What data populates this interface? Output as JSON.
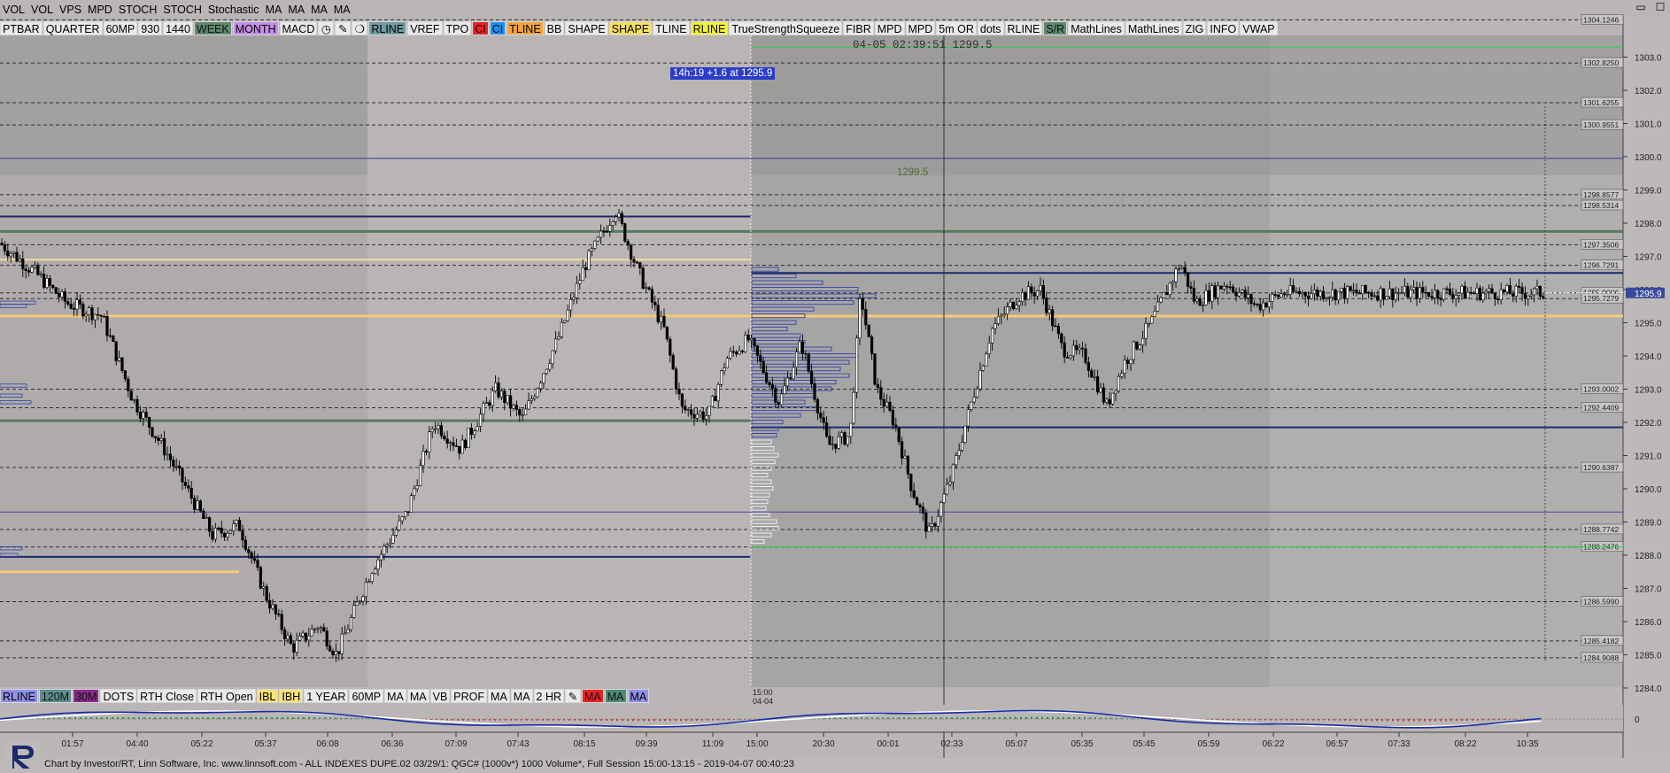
{
  "toolbar_top": [
    "VOL",
    "VOL",
    "VPS",
    "MPD",
    "STOCH",
    "STOCH",
    "Stochastic",
    "MA",
    "MA",
    "MA",
    "MA"
  ],
  "toolbar_main": [
    {
      "label": "PTBAR",
      "bg": "#eaeaea"
    },
    {
      "label": "QUARTER",
      "bg": "#eaeaea"
    },
    {
      "label": "60MP",
      "bg": "#eaeaea"
    },
    {
      "label": "930",
      "bg": "#eaeaea"
    },
    {
      "label": "1440",
      "bg": "#eaeaea"
    },
    {
      "label": "WEEK",
      "bg": "#5e8a6f"
    },
    {
      "label": "MONTH",
      "bg": "#c58ee8"
    },
    {
      "label": "MACD",
      "bg": "#eaeaea"
    },
    {
      "label": "clock-icon",
      "bg": "#eaeaea",
      "icon": true,
      "glyph": "◷"
    },
    {
      "label": "pencil-icon",
      "bg": "#eaeaea",
      "icon": true,
      "glyph": "✎"
    },
    {
      "label": "dropper-icon",
      "bg": "#eaeaea",
      "icon": true,
      "glyph": "❍"
    },
    {
      "label": "RLINE",
      "bg": "#6f9ba2"
    },
    {
      "label": "VREF",
      "bg": "#eaeaea"
    },
    {
      "label": "TPO",
      "bg": "#eaeaea"
    },
    {
      "label": "CI",
      "bg": "#ee2222"
    },
    {
      "label": "CI",
      "bg": "#1f8ff0"
    },
    {
      "label": "TLINE",
      "bg": "#f3a33a"
    },
    {
      "label": "BB",
      "bg": "#eaeaea"
    },
    {
      "label": "SHAPE",
      "bg": "#eaeaea"
    },
    {
      "label": "SHAPE",
      "bg": "#f7df62"
    },
    {
      "label": "TLINE",
      "bg": "#eaeaea"
    },
    {
      "label": "RLINE",
      "bg": "#f2f23a"
    },
    {
      "label": "TrueStrengthSqueeze",
      "bg": "#eaeaea"
    },
    {
      "label": "FIBR",
      "bg": "#eaeaea"
    },
    {
      "label": "MPD",
      "bg": "#eaeaea"
    },
    {
      "label": "MPD",
      "bg": "#eaeaea"
    },
    {
      "label": "5m OR",
      "bg": "#eaeaea"
    },
    {
      "label": "dots",
      "bg": "#eaeaea"
    },
    {
      "label": "RLINE",
      "bg": "#eaeaea"
    },
    {
      "label": "S/R",
      "bg": "#5e8a6f"
    },
    {
      "label": "MathLines",
      "bg": "#eaeaea"
    },
    {
      "label": "MathLines",
      "bg": "#eaeaea"
    },
    {
      "label": "ZIG",
      "bg": "#eaeaea"
    },
    {
      "label": "INFO",
      "bg": "#eaeaea"
    },
    {
      "label": "VWAP",
      "bg": "#eaeaea"
    }
  ],
  "toolbar_bottom": [
    {
      "label": "RLINE",
      "bg": "#8f8fe8"
    },
    {
      "label": "120M",
      "bg": "#5c8f8c"
    },
    {
      "label": "30M",
      "bg": "#8a2a8a"
    },
    {
      "label": "DOTS",
      "bg": "#eaeaea"
    },
    {
      "label": "RTH Close",
      "bg": "#eaeaea"
    },
    {
      "label": "RTH Open",
      "bg": "#eaeaea"
    },
    {
      "label": "IBL",
      "bg": "#f7e27a"
    },
    {
      "label": "IBH",
      "bg": "#f7e27a"
    },
    {
      "label": "1 YEAR",
      "bg": "#eaeaea"
    },
    {
      "label": "60MP",
      "bg": "#eaeaea"
    },
    {
      "label": "MA",
      "bg": "#eaeaea"
    },
    {
      "label": "MA",
      "bg": "#eaeaea"
    },
    {
      "label": "VB",
      "bg": "#eaeaea"
    },
    {
      "label": "PROF",
      "bg": "#eaeaea"
    },
    {
      "label": "MA",
      "bg": "#eaeaea"
    },
    {
      "label": "MA",
      "bg": "#eaeaea"
    },
    {
      "label": "2 HR",
      "bg": "#eaeaea"
    },
    {
      "label": "pencil-icon",
      "bg": "#eaeaea",
      "icon": true,
      "glyph": "✎"
    },
    {
      "label": "MA",
      "bg": "#ee2222"
    },
    {
      "label": "MA",
      "bg": "#4f8a78"
    },
    {
      "label": "MA",
      "bg": "#8f8fe8"
    }
  ],
  "cursor_readout": "04-05 02:39:51  1299.5",
  "callout": "14h:19  +1.6 at 1295.9",
  "level_label": "1299.5",
  "session_marker": [
    "15:00",
    "04-04"
  ],
  "footer_text": "Chart by Investor/RT, Linn Software, Inc. www.linnsoft.com - ALL INDEXES DUPE.02    03/29/1: QGC# (1000v*) 1000 Volume*, Full Session 15:00-13:15 - 2019-04-07 00:40:23",
  "window_controls": [
    "▭",
    "☐"
  ],
  "chart_data": {
    "type": "candlestick",
    "symbol": "QGC# (1000v*)",
    "ylim": [
      1283.3,
      1304.6
    ],
    "y_ticks": [
      1284.0,
      1285.0,
      1286.0,
      1287.0,
      1288.0,
      1289.0,
      1290.0,
      1291.0,
      1292.0,
      1293.0,
      1294.0,
      1295.0,
      1296.0,
      1297.0,
      1298.0,
      1299.0,
      1300.0,
      1301.0,
      1302.0,
      1303.0
    ],
    "x_tick_labels": [
      "01:57",
      "04:40",
      "05:22",
      "05:37",
      "06:08",
      "06:36",
      "07:09",
      "07:43",
      "08:15",
      "09:39",
      "11:09",
      "15:00",
      "20:30",
      "00:01",
      "02:33",
      "05:07",
      "05:35",
      "05:45",
      "05:59",
      "06:22",
      "06:57",
      "07:33",
      "08:22",
      "10:35"
    ],
    "price_levels": [
      {
        "price": 1304.1246,
        "label": "1304.1246",
        "style": "dash",
        "color": "#333333"
      },
      {
        "price": 1302.825,
        "label": "1302.8250",
        "style": "dash",
        "color": "#333333"
      },
      {
        "price": 1301.6255,
        "label": "1301.6255",
        "style": "dash",
        "color": "#333333"
      },
      {
        "price": 1300.9551,
        "label": "1300.9551",
        "style": "dash",
        "color": "#333333"
      },
      {
        "price": 1298.8577,
        "label": "1298.8577",
        "style": "dash",
        "color": "#333333"
      },
      {
        "price": 1298.5314,
        "label": "1298.5314",
        "style": "dash",
        "color": "#333333"
      },
      {
        "price": 1297.3506,
        "label": "1297.3506",
        "style": "dash",
        "color": "#333333"
      },
      {
        "price": 1296.7291,
        "label": "1296.7291",
        "style": "dash",
        "color": "#333333"
      },
      {
        "price": 1295.9006,
        "label": "1295.9006",
        "style": "dash",
        "color": "#333333"
      },
      {
        "price": 1295.7279,
        "label": "1295.7279",
        "style": "dash",
        "color": "#333333"
      },
      {
        "price": 1293.0002,
        "label": "1293.0002",
        "style": "dash",
        "color": "#333333"
      },
      {
        "price": 1292.4409,
        "label": "1292.4409",
        "style": "dash",
        "color": "#333333"
      },
      {
        "price": 1290.6387,
        "label": "1290.6387",
        "style": "dash",
        "color": "#333333"
      },
      {
        "price": 1288.7742,
        "label": "1288.7742",
        "style": "dash",
        "color": "#333333"
      },
      {
        "price": 1288.2476,
        "label": "1288.2476",
        "style": "dash",
        "color": "#333333"
      },
      {
        "price": 1286.599,
        "label": "1286.5990",
        "style": "dash",
        "color": "#333333"
      },
      {
        "price": 1285.4182,
        "label": "1285.4182",
        "style": "dash",
        "color": "#333333"
      },
      {
        "price": 1284.9088,
        "label": "1284.9088",
        "style": "dash",
        "color": "#333333"
      }
    ],
    "last_price": "1295.9",
    "swing_points": [
      {
        "x": 0,
        "y": 1297.4
      },
      {
        "x": 40,
        "y": 1296.5
      },
      {
        "x": 75,
        "y": 1295.6
      },
      {
        "x": 115,
        "y": 1295.2
      },
      {
        "x": 150,
        "y": 1292.7
      },
      {
        "x": 190,
        "y": 1291.0
      },
      {
        "x": 240,
        "y": 1288.6
      },
      {
        "x": 270,
        "y": 1288.9
      },
      {
        "x": 300,
        "y": 1286.8
      },
      {
        "x": 330,
        "y": 1285.2
      },
      {
        "x": 360,
        "y": 1285.9
      },
      {
        "x": 380,
        "y": 1285.0
      },
      {
        "x": 420,
        "y": 1287.6
      },
      {
        "x": 460,
        "y": 1289.3
      },
      {
        "x": 490,
        "y": 1292.0
      },
      {
        "x": 520,
        "y": 1291.2
      },
      {
        "x": 560,
        "y": 1293.0
      },
      {
        "x": 590,
        "y": 1292.1
      },
      {
        "x": 630,
        "y": 1294.5
      },
      {
        "x": 660,
        "y": 1296.7
      },
      {
        "x": 695,
        "y": 1298.4
      },
      {
        "x": 720,
        "y": 1296.6
      },
      {
        "x": 750,
        "y": 1294.8
      },
      {
        "x": 770,
        "y": 1292.4
      },
      {
        "x": 800,
        "y": 1292.2
      },
      {
        "x": 820,
        "y": 1293.9
      },
      {
        "x": 845,
        "y": 1294.5
      },
      {
        "x": 880,
        "y": 1292.6
      },
      {
        "x": 905,
        "y": 1294.4
      },
      {
        "x": 935,
        "y": 1291.3
      },
      {
        "x": 960,
        "y": 1291.6
      },
      {
        "x": 972,
        "y": 1295.9
      },
      {
        "x": 990,
        "y": 1293.0
      },
      {
        "x": 1010,
        "y": 1292.0
      },
      {
        "x": 1030,
        "y": 1290.0
      },
      {
        "x": 1050,
        "y": 1288.6
      },
      {
        "x": 1075,
        "y": 1290.4
      },
      {
        "x": 1095,
        "y": 1292.4
      },
      {
        "x": 1120,
        "y": 1294.8
      },
      {
        "x": 1150,
        "y": 1295.8
      },
      {
        "x": 1175,
        "y": 1296.0
      },
      {
        "x": 1200,
        "y": 1294.2
      },
      {
        "x": 1225,
        "y": 1294.0
      },
      {
        "x": 1250,
        "y": 1292.5
      },
      {
        "x": 1270,
        "y": 1293.8
      },
      {
        "x": 1300,
        "y": 1295.0
      },
      {
        "x": 1333,
        "y": 1296.8
      },
      {
        "x": 1350,
        "y": 1295.6
      },
      {
        "x": 1385,
        "y": 1296.2
      },
      {
        "x": 1420,
        "y": 1295.5
      },
      {
        "x": 1450,
        "y": 1295.9
      }
    ]
  }
}
